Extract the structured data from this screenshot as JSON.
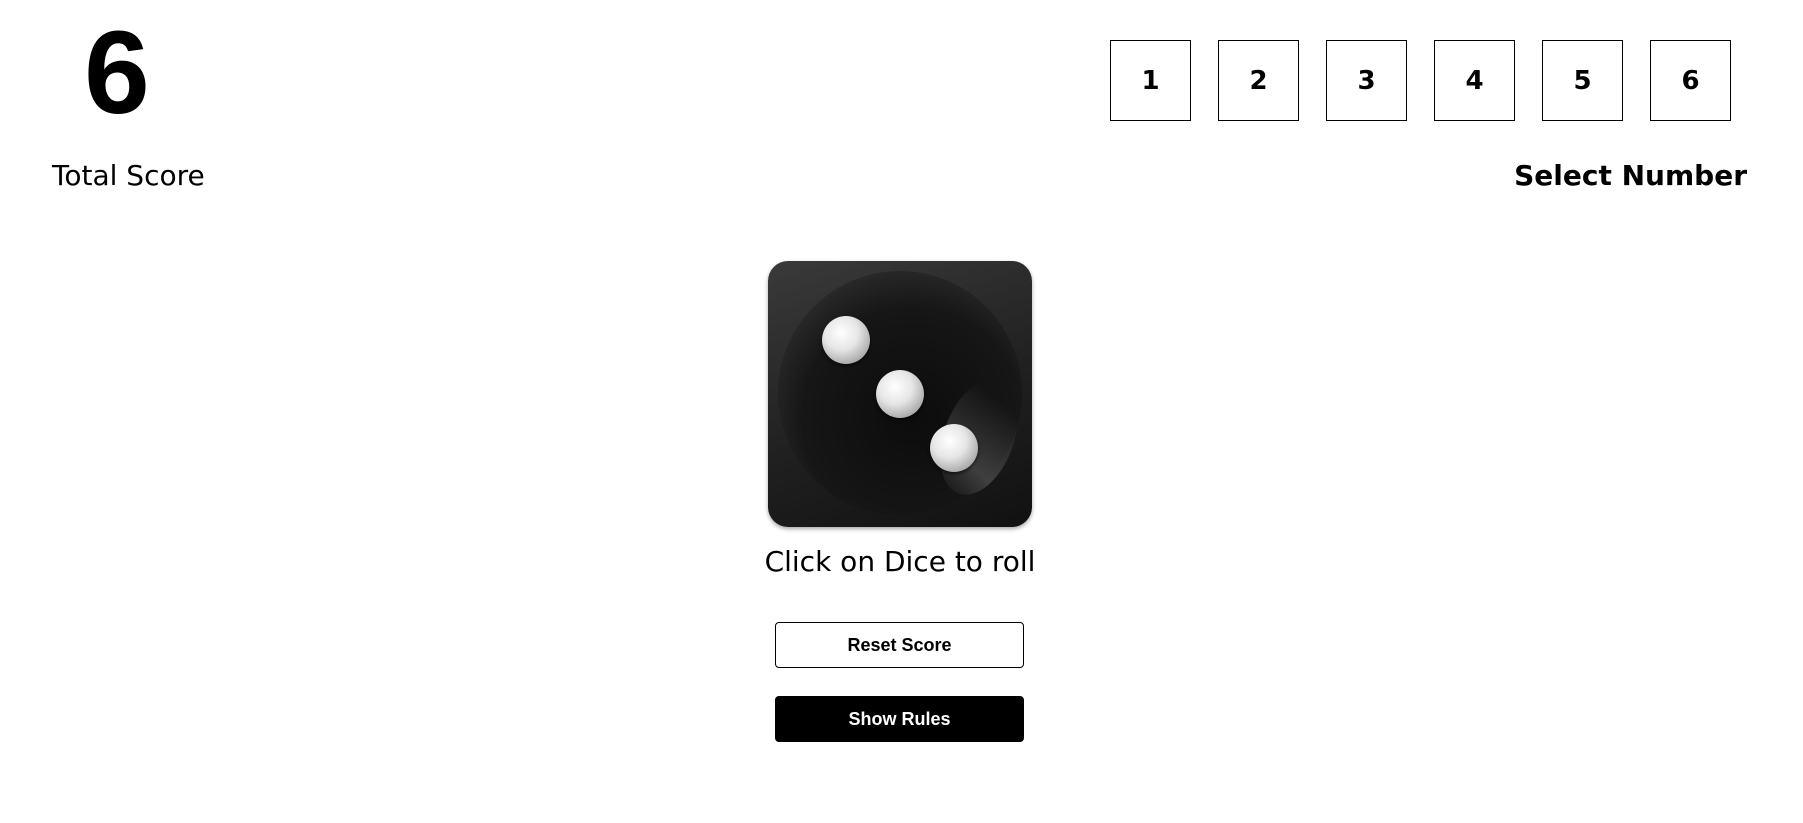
{
  "score": {
    "value": "6",
    "label": "Total Score"
  },
  "number_selector": {
    "label": "Select Number",
    "options": [
      "1",
      "2",
      "3",
      "4",
      "5",
      "6"
    ]
  },
  "dice": {
    "face_value": 3,
    "caption": "Click on Dice to roll"
  },
  "buttons": {
    "reset_label": "Reset Score",
    "rules_label": "Show Rules"
  },
  "colors": {
    "background": "#ffffff",
    "text": "#000000",
    "dice_body": "#202020",
    "primary_button": "#000000"
  }
}
